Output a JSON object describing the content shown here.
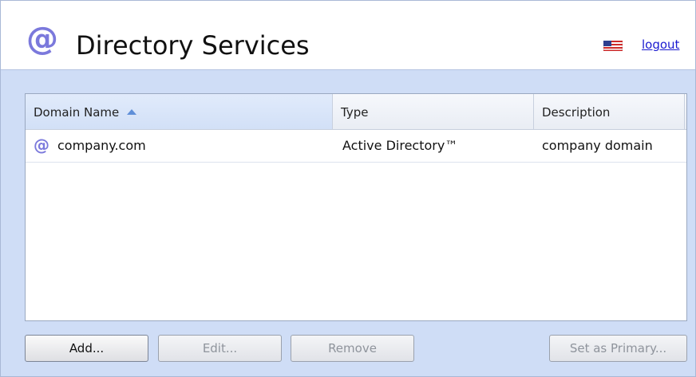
{
  "header": {
    "icon": "at-sign-icon",
    "icon_glyph": "@",
    "title": "Directory Services",
    "flag_icon": "us-flag-icon",
    "logout_label": "logout"
  },
  "grid": {
    "columns": [
      {
        "label": "Domain Name",
        "sorted": "ascending"
      },
      {
        "label": "Type"
      },
      {
        "label": "Description"
      }
    ],
    "rows": [
      {
        "icon": "at-sign-icon",
        "icon_glyph": "@",
        "domain_name": "company.com",
        "type": "Active Directory™",
        "description": "company domain"
      }
    ]
  },
  "buttons": {
    "add": {
      "label": "Add...",
      "enabled": true
    },
    "edit": {
      "label": "Edit...",
      "enabled": false
    },
    "remove": {
      "label": "Remove",
      "enabled": false
    },
    "set_primary": {
      "label": "Set as Primary...",
      "enabled": false
    }
  },
  "colors": {
    "accent_icon": "#7b79dc",
    "body_background": "#cfddf6",
    "link": "#1a1ad0",
    "sort_arrow": "#5f8fd8"
  }
}
